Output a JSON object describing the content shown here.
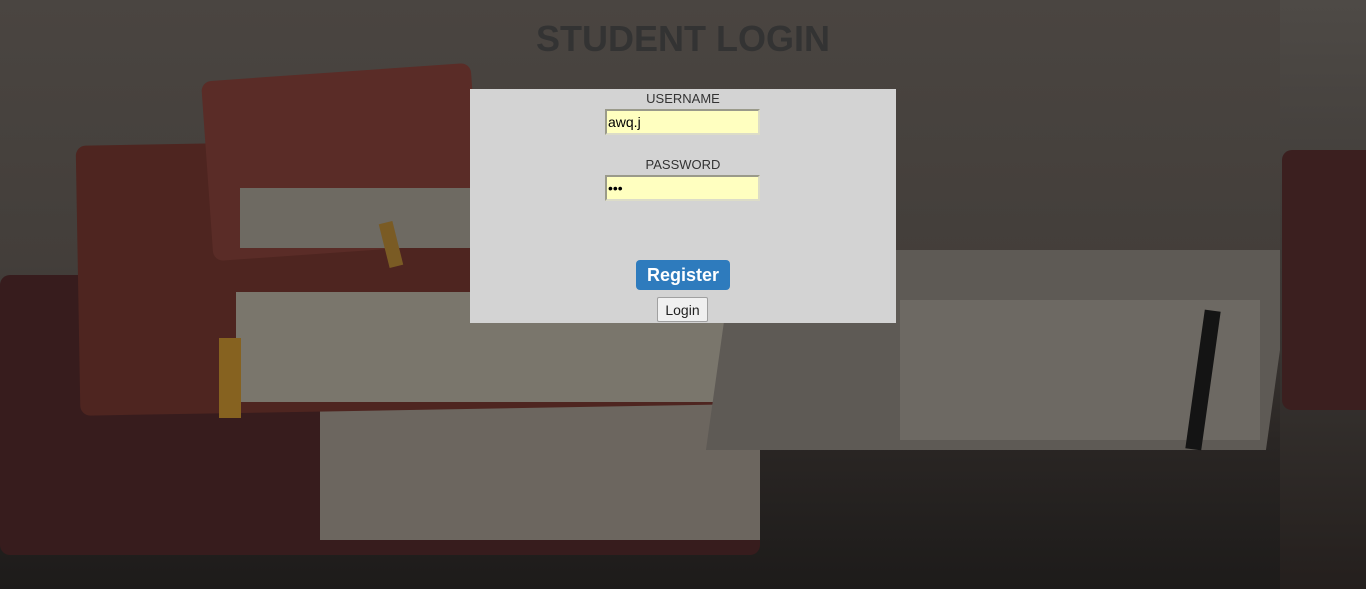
{
  "page": {
    "title": "STUDENT LOGIN"
  },
  "form": {
    "username_label": "USERNAME",
    "username_value": "awq.j",
    "password_label": "PASSWORD",
    "password_value": "***",
    "register_label": "Register",
    "login_label": "Login"
  },
  "colors": {
    "panel_bg": "#d3d3d3",
    "input_bg": "#ffffc0",
    "register_bg": "#2e7bbd",
    "title_color": "#333333"
  }
}
